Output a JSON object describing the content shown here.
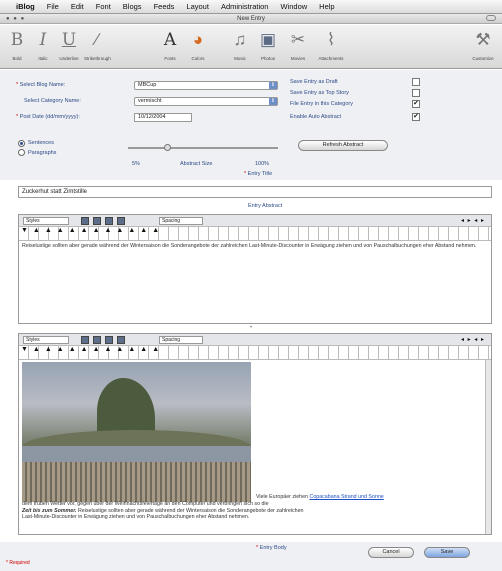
{
  "menubar": {
    "items": [
      "iBlog",
      "File",
      "Edit",
      "Font",
      "Blogs",
      "Feeds",
      "Layout",
      "Administration",
      "Window",
      "Help"
    ]
  },
  "window": {
    "title": "New Entry"
  },
  "toolbar": {
    "buttons": [
      {
        "label": "Bold",
        "icon": "bold-icon",
        "glyph": "B"
      },
      {
        "label": "Italic",
        "icon": "italic-icon",
        "glyph": "I"
      },
      {
        "label": "Underline",
        "icon": "underline-icon",
        "glyph": "U"
      },
      {
        "label": "Strikethrough",
        "icon": "strike-icon",
        "glyph": "∕"
      },
      {
        "label": "Fonts",
        "icon": "fonts-icon",
        "glyph": "A"
      },
      {
        "label": "Colors",
        "icon": "colors-icon",
        "glyph": "◕"
      },
      {
        "label": "Music",
        "icon": "music-icon",
        "glyph": "♫"
      },
      {
        "label": "Photos",
        "icon": "photos-icon",
        "glyph": "▣"
      },
      {
        "label": "Movies",
        "icon": "movies-icon",
        "glyph": "✂"
      },
      {
        "label": "Attachments",
        "icon": "attachments-icon",
        "glyph": "⌇"
      },
      {
        "label": "Customize",
        "icon": "customize-icon",
        "glyph": "⚒"
      }
    ]
  },
  "form": {
    "blog_name_label": "Select Blog Name:",
    "blog_name_value": "MBCup",
    "category_label": "Select Category Name:",
    "category_value": "vermischt",
    "post_date_label": "Post Date (dd/mm/yyyy):",
    "post_date_value": "10/12/2004",
    "save_draft_label": "Save Entry as Draft",
    "save_draft_checked": false,
    "save_top_label": "Save Entry as Top Story",
    "save_top_checked": false,
    "file_in_category_label": "File Entry in this Category",
    "file_in_category_checked": true,
    "auto_abstract_label": "Enable Auto Abstract",
    "auto_abstract_checked": true,
    "radio_sentences": "Sentences",
    "radio_paragraphs": "Paragraphs",
    "slider_level": 0.25,
    "abstract_min": "5%",
    "abstract_size_label": "Abstract Size",
    "abstract_max": "100%",
    "refresh_button": "Refresh Abstract",
    "entry_title_caption": "Entry Title"
  },
  "entry": {
    "title_value": "Zuckerhut statt Zimtstille",
    "abstract_caption": "Entry Abstract",
    "abstract_text": "Reiselustige sollten aber gerade während der Wintersaison die Sonderangebote der zahlreichen Last-Minute-Discounter in Erwägung ziehen und von Pauschalbuchungen eher Abstand nehmen.",
    "body_caption": "Entry Body",
    "body_caption_right_prefix": "Viele Europäer ziehen ",
    "body_caption_right_link": "Copacabana Strand und Sonne",
    "body_line1": "dem trüben Wetter vor, gegen über der Weihnachtsfeiertage an den Computer und verbringen sich so die",
    "body_line2_bold": "Zeit bis zum Sommer.",
    "body_line2_rest": " Reiselustige sollten aber gerade während der Wintersaison die Sonderangebote der zahlreichen",
    "body_line3": "Last-Minute-Discounter in Erwägung ziehen und von Pauschalbuchungen eher Abstand nehmen."
  },
  "editor_bar": {
    "style_value": "Styles",
    "spacing_value": "Spacing",
    "nav": "◂ ▸ ◂ ▸"
  },
  "buttons": {
    "cancel": "Cancel",
    "save": "Save"
  },
  "footer": {
    "required_note": "* Required"
  }
}
